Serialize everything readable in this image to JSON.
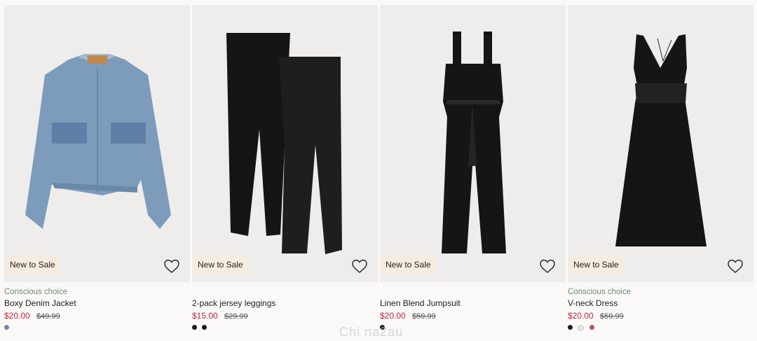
{
  "products": [
    {
      "badge": "New to Sale",
      "conscious": "Conscious choice",
      "title": "Boxy Denim Jacket",
      "sale_price": "$20.00",
      "original_price": "$49.99",
      "swatches": [
        "#7b85a8"
      ]
    },
    {
      "badge": "New to Sale",
      "conscious": "",
      "title": "2-pack jersey leggings",
      "sale_price": "$15.00",
      "original_price": "$29.99",
      "swatches": [
        "#1a1a1a",
        "#1a1a1a"
      ]
    },
    {
      "badge": "New to Sale",
      "conscious": "",
      "title": "Linen Blend Jumpsuit",
      "sale_price": "$20.00",
      "original_price": "$59.99",
      "swatches": [
        "#1a1a1a"
      ]
    },
    {
      "badge": "New to Sale",
      "conscious": "Conscious choice",
      "title": "V-neck Dress",
      "sale_price": "$20.00",
      "original_price": "$59.99",
      "swatches": [
        "#1a1a1a",
        "#e9e4df",
        "#b0584f"
      ]
    }
  ],
  "watermark": "Chi na2au",
  "colors": {
    "sale": "#c7253e",
    "conscious": "#6f8a70",
    "badge_bg": "#f5ecdf",
    "image_bg": "#efedeb"
  },
  "icons": {
    "favorite": "heart-outline-icon"
  }
}
